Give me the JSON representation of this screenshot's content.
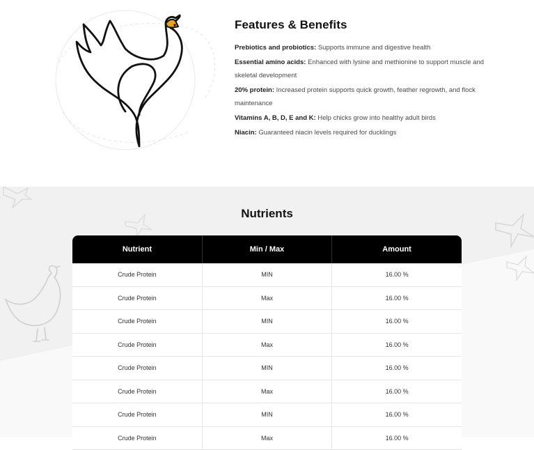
{
  "features": {
    "title": "Features & Benefits",
    "items": [
      {
        "label": "Prebiotics and probiotics:",
        "text": " Supports immune and digestive health"
      },
      {
        "label": "Essential amino acids:",
        "text": " Enhanced with lysine and methionine to support muscle and skeletal development"
      },
      {
        "label": "20% protein:",
        "text": " Increased protein supports quick growth, feather regrowth, and flock maintenance"
      },
      {
        "label": "Vitamins A, B, D, E and K:",
        "text": " Help chicks grow into healthy adult birds"
      },
      {
        "label": "Niacin:",
        "text": " Guaranteed niacin levels required for ducklings"
      }
    ]
  },
  "nutrients": {
    "title": "Nutrients",
    "headers": [
      "Nutrient",
      "Min / Max",
      "Amount"
    ],
    "rows": [
      [
        "Crude Protein",
        "MIN",
        "16.00 %"
      ],
      [
        "Crude Protein",
        "Max",
        "16.00 %"
      ],
      [
        "Crude Protein",
        "MIN",
        "16.00 %"
      ],
      [
        "Crude Protein",
        "Max",
        "16.00 %"
      ],
      [
        "Crude Protein",
        "MIN",
        "16.00 %"
      ],
      [
        "Crude Protein",
        "Max",
        "16.00 %"
      ],
      [
        "Crude Protein",
        "MIN",
        "16.00 %"
      ],
      [
        "Crude Protein",
        "Max",
        "16.00 %"
      ]
    ]
  },
  "colors": {
    "accent": "#e8a321",
    "header_bg": "#000000",
    "section_bg": "#f1f1f1"
  },
  "icons": {
    "hero": "chicken-line-art-icon",
    "background": [
      "airplane-icon",
      "chicken-outline-icon"
    ]
  }
}
